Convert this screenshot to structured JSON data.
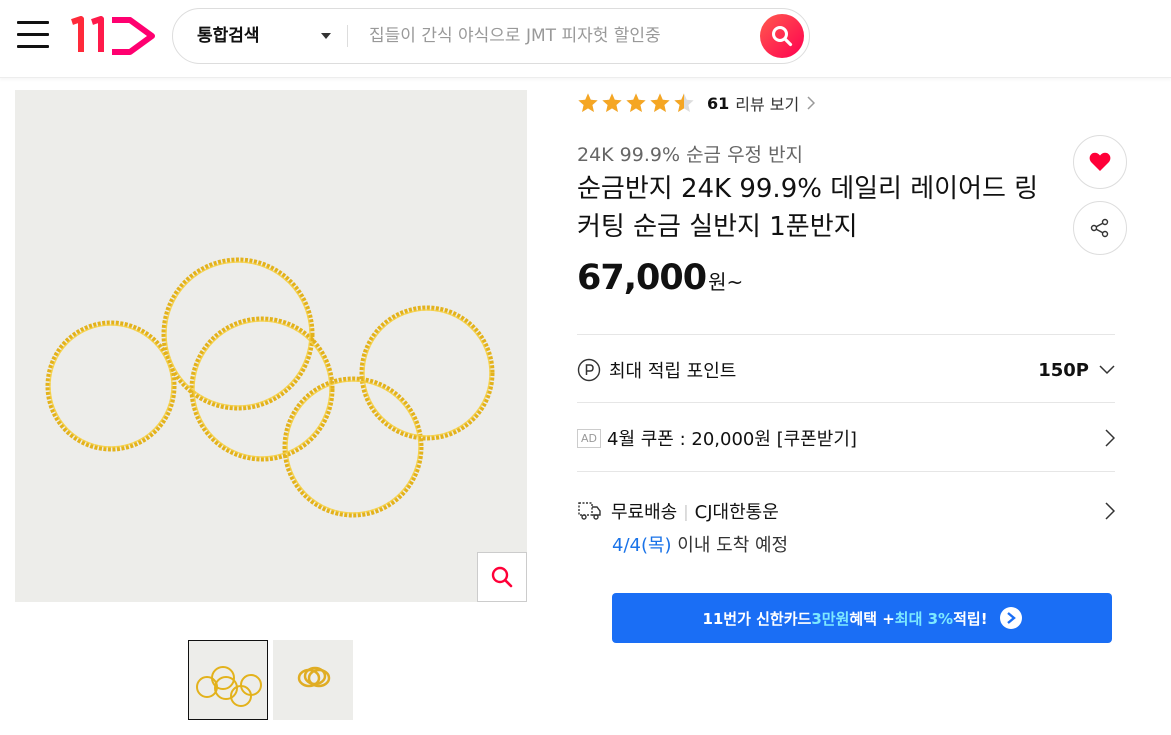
{
  "header": {
    "menu_icon": "hamburger-icon",
    "logo_text": "11",
    "search": {
      "category": "통합검색",
      "placeholder": "집들이 간식 야식으로 JMT 피자헛 할인중",
      "button_icon": "search-icon"
    }
  },
  "product": {
    "rating": 4.5,
    "review_count": "61",
    "review_link": "리뷰 보기",
    "subtitle": "24K 99.9% 순금 우정 반지",
    "title": "순금반지 24K 99.9% 데일리 레이어드 링 커팅 순금 실반지 1푼반지",
    "price": "67,000",
    "price_unit": "원~",
    "points_label": "최대 적립 포인트",
    "points_value": "150P",
    "ad_tag": "AD",
    "coupon_text": "4월 쿠폰 : 20,000원 [쿠폰받기]",
    "shipping": "무료배송",
    "courier": "CJ대한통운",
    "eta_date": "4/4(목)",
    "eta_text": " 이내 도착 예정"
  },
  "promo": {
    "part1": "11번가 신한카드 ",
    "highlight1": "3만원",
    "part2": " 혜택 + ",
    "highlight2": "최대 3%",
    "part3": " 적립!"
  },
  "colors": {
    "brand": "#ff0038",
    "star": "#f5a623",
    "link_blue": "#1a73e8",
    "promo_bg": "#1a6ef5",
    "promo_highlight": "#7de9ff"
  }
}
